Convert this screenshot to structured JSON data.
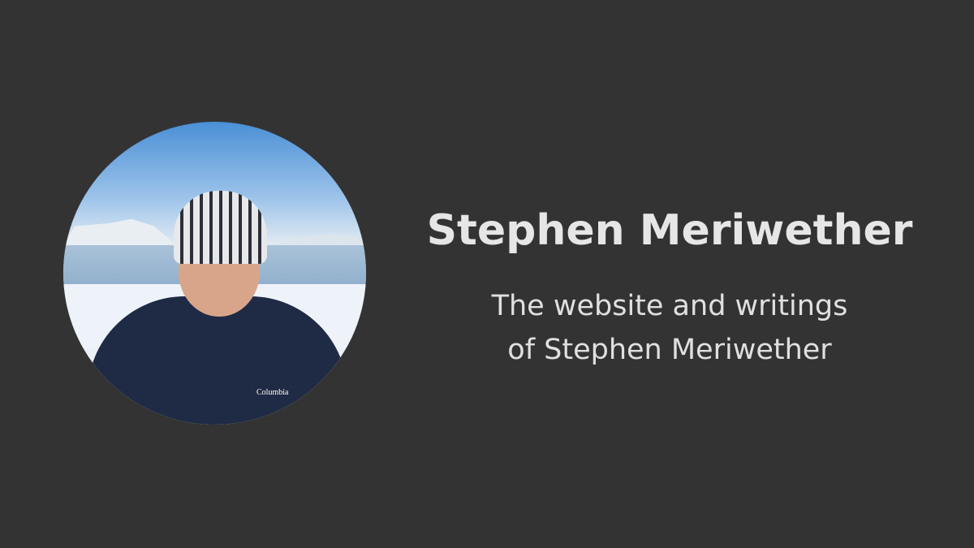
{
  "profile": {
    "name": "Stephen Meriwether",
    "tagline_line1": "The website and writings",
    "tagline_line2": "of Stephen Meriwether",
    "photo_jacket_logo": "Columbia"
  },
  "colors": {
    "background": "#333333",
    "text": "#e6e6e6"
  }
}
